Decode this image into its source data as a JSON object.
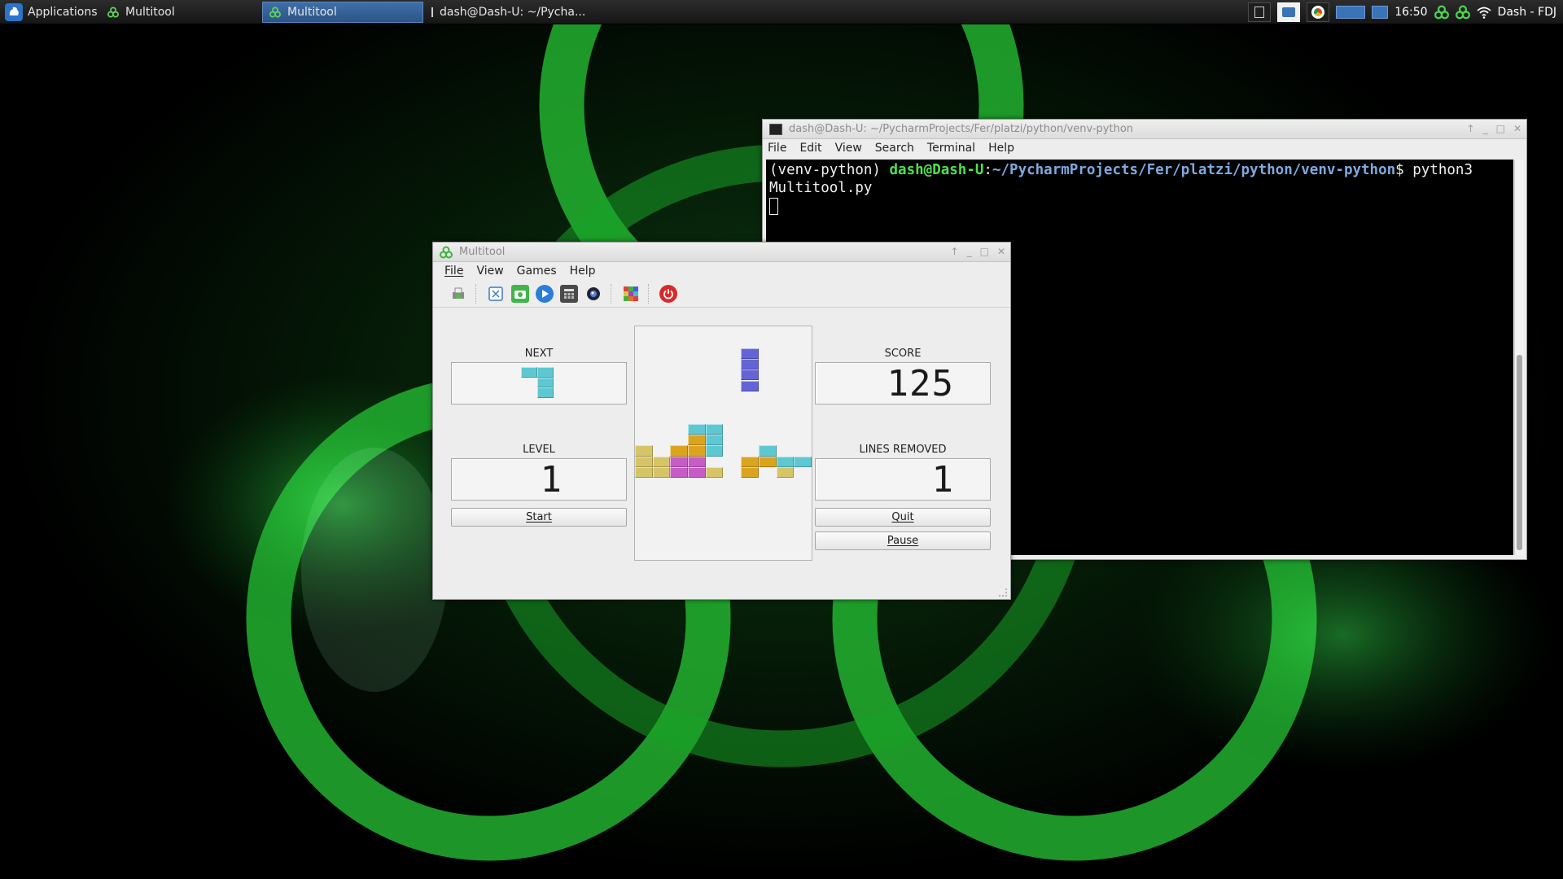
{
  "taskbar": {
    "apps_label": "Applications",
    "tasks": [
      {
        "label": "Multitool",
        "active": false
      },
      {
        "label": "Multitool",
        "active": true
      },
      {
        "label": "dash@Dash-U: ~/Pycha...",
        "active": false
      }
    ],
    "clock": "16:50",
    "user": "Dash - FDJ"
  },
  "terminal": {
    "title": "dash@Dash-U: ~/PycharmProjects/Fer/platzi/python/venv-python",
    "menu": [
      "File",
      "Edit",
      "View",
      "Search",
      "Terminal",
      "Help"
    ],
    "venv": "(venv-python) ",
    "user_host": "dash@Dash-U",
    "colon": ":",
    "path": "~/PycharmProjects/Fer/platzi/python/venv-python",
    "prompt_tail": "$ python3",
    "line2": "Multitool.py"
  },
  "multitool": {
    "title": "Multitool",
    "menu": [
      "File",
      "View",
      "Games",
      "Help"
    ],
    "toolbar_icons": [
      "print-icon",
      "screenshot-tool-icon",
      "camera-icon",
      "play-icon",
      "calculator-icon",
      "webcam-icon",
      "tetris-icon",
      "power-icon"
    ],
    "next_label": "NEXT",
    "level_label": "LEVEL",
    "score_label": "SCORE",
    "lines_label": "LINES REMOVED",
    "level_value": "1",
    "score_value": "125",
    "lines_value": "1",
    "start_label": "Start",
    "quit_label": "Quit",
    "pause_label": "Pause"
  },
  "tetris": {
    "cols": 10,
    "rows": 13,
    "colors": {
      "cyan": "#5ec8d2",
      "yellow": "#d6c567",
      "gold": "#dba41f",
      "magenta": "#c65cc6",
      "purple": "#6464d6"
    },
    "next_piece": {
      "color": "cyan",
      "cells": [
        [
          0,
          0
        ],
        [
          1,
          0
        ],
        [
          1,
          1
        ],
        [
          1,
          2
        ]
      ]
    },
    "falling_piece": {
      "color": "purple",
      "cells": [
        [
          6,
          2
        ],
        [
          6,
          3
        ],
        [
          6,
          4
        ],
        [
          6,
          5
        ]
      ]
    },
    "locked": [
      {
        "c": 3,
        "r": 9,
        "color": "cyan"
      },
      {
        "c": 4,
        "r": 9,
        "color": "cyan"
      },
      {
        "c": 3,
        "r": 10,
        "color": "gold"
      },
      {
        "c": 4,
        "r": 10,
        "color": "cyan"
      },
      {
        "c": 3,
        "r": 11,
        "color": "gold"
      },
      {
        "c": 4,
        "r": 11,
        "color": "cyan"
      },
      {
        "c": 0,
        "r": 11,
        "color": "yellow"
      },
      {
        "c": 2,
        "r": 11,
        "color": "gold"
      },
      {
        "c": 7,
        "r": 11,
        "color": "cyan"
      },
      {
        "c": 0,
        "r": 12,
        "color": "yellow"
      },
      {
        "c": 1,
        "r": 12,
        "color": "yellow"
      },
      {
        "c": 2,
        "r": 12,
        "color": "magenta"
      },
      {
        "c": 3,
        "r": 12,
        "color": "magenta"
      },
      {
        "c": 6,
        "r": 12,
        "color": "gold"
      },
      {
        "c": 7,
        "r": 12,
        "color": "gold"
      },
      {
        "c": 8,
        "r": 12,
        "color": "cyan"
      },
      {
        "c": 9,
        "r": 12,
        "color": "cyan"
      },
      {
        "c": 0,
        "r": 13,
        "color": "yellow"
      },
      {
        "c": 1,
        "r": 13,
        "color": "yellow"
      },
      {
        "c": 2,
        "r": 13,
        "color": "magenta"
      },
      {
        "c": 3,
        "r": 13,
        "color": "magenta"
      },
      {
        "c": 4,
        "r": 13,
        "color": "yellow"
      },
      {
        "c": 6,
        "r": 13,
        "color": "gold"
      },
      {
        "c": 8,
        "r": 13,
        "color": "yellow"
      }
    ]
  }
}
